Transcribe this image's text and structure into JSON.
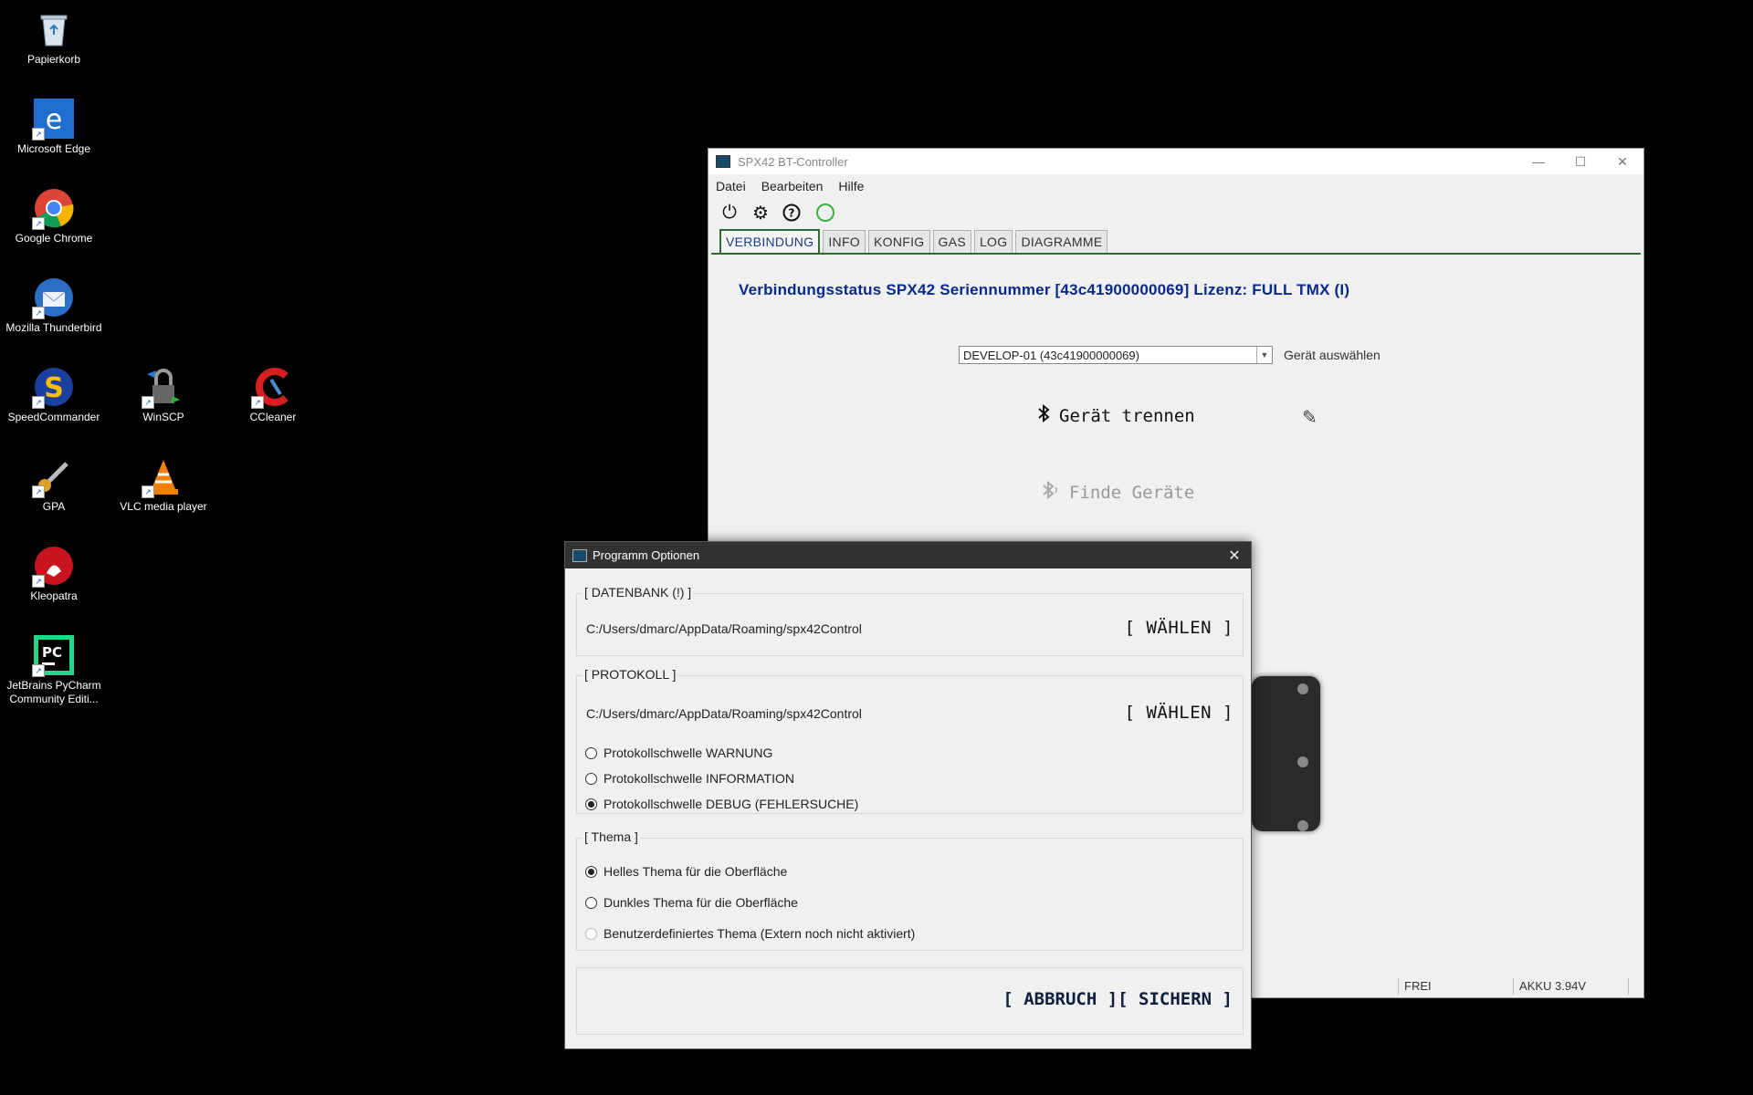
{
  "desktop": {
    "icons": [
      {
        "label": "Papierkorb"
      },
      {
        "label": "Microsoft Edge"
      },
      {
        "label": "Google Chrome"
      },
      {
        "label": "Mozilla Thunderbird"
      },
      {
        "label": "SpeedCommander"
      },
      {
        "label": "WinSCP"
      },
      {
        "label": "CCleaner"
      },
      {
        "label": "GPA"
      },
      {
        "label": "VLC media player"
      },
      {
        "label": "Kleopatra"
      },
      {
        "label": "JetBrains PyCharm Community Editi..."
      }
    ]
  },
  "main_window": {
    "title": "SPX42 BT-Controller",
    "menu": [
      "Datei",
      "Bearbeiten",
      "Hilfe"
    ],
    "tabs": [
      "VERBINDUNG",
      "INFO",
      "KONFIG",
      "GAS",
      "LOG",
      "DIAGRAMME"
    ],
    "connection_status": "Verbindungsstatus SPX42 Seriennummer [43c41900000069] Lizenz: FULL TMX (I)",
    "device_select_value": "DEVELOP-01 (43c41900000069)",
    "device_select_label": "Gerät auswählen",
    "disconnect_label": "Gerät trennen",
    "find_devices_label": "Finde Geräte",
    "status_free": "FREI",
    "status_battery": "AKKU 3.94V"
  },
  "dialog": {
    "title": "Programm Optionen",
    "database": {
      "title": "[ DATENBANK (!) ]",
      "path": "C:/Users/dmarc/AppData/Roaming/spx42Control",
      "button": "[ WÄHLEN ]"
    },
    "protocol": {
      "title": "[ PROTOKOLL ]",
      "path": "C:/Users/dmarc/AppData/Roaming/spx42Control",
      "button": "[ WÄHLEN ]",
      "options": [
        {
          "label": "Protokollschwelle WARNUNG",
          "checked": false
        },
        {
          "label": "Protokollschwelle INFORMATION",
          "checked": false
        },
        {
          "label": "Protokollschwelle DEBUG (FEHLERSUCHE)",
          "checked": true
        }
      ]
    },
    "theme": {
      "title": "[ Thema ]",
      "options": [
        {
          "label": "Helles Thema für die Oberfläche",
          "checked": true
        },
        {
          "label": "Dunkles Thema für die Oberfläche",
          "checked": false
        },
        {
          "label": "Benutzerdefiniertes Thema (Extern noch nicht aktiviert)",
          "checked": false,
          "disabled": true
        }
      ]
    },
    "cancel_button": "[ ABBRUCH ]",
    "save_button": "[ SICHERN ]"
  }
}
